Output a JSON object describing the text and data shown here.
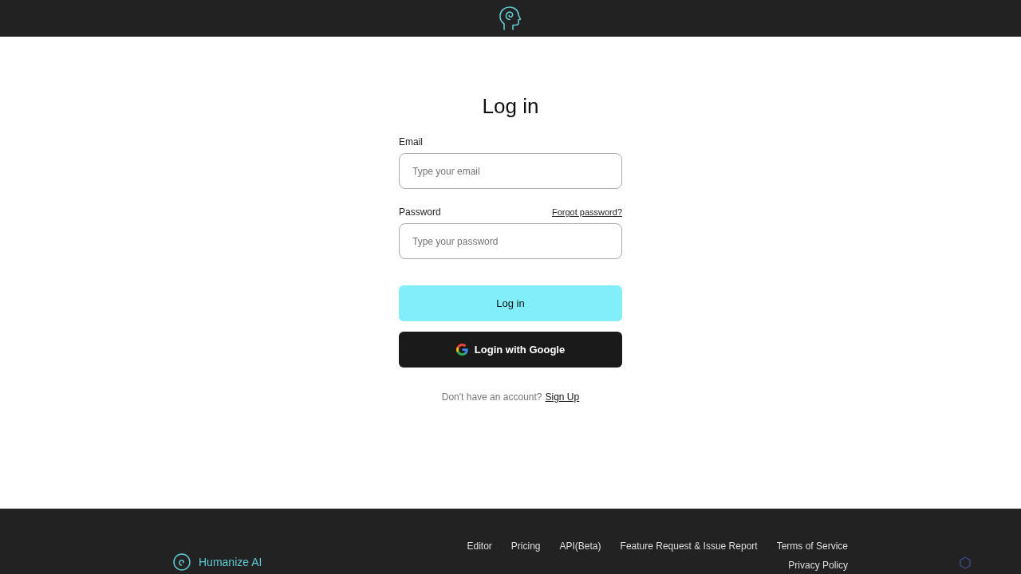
{
  "form": {
    "title": "Log in",
    "fields": [
      {
        "label": "Email",
        "placeholder": "Type your email"
      },
      {
        "label": "Password",
        "placeholder": "Type your password",
        "link": "Forgot password?"
      }
    ],
    "submit": "Log in",
    "google": "Login with Google",
    "signup_prompt": "Don't have an account?",
    "signup_link": "Sign Up"
  },
  "footer": {
    "brand": "Humanize AI",
    "links": [
      "Editor",
      "Pricing",
      "API(Beta)",
      "Feature Request & Issue Report",
      "Terms of Service"
    ],
    "second_links": [
      "Privacy Policy"
    ]
  }
}
